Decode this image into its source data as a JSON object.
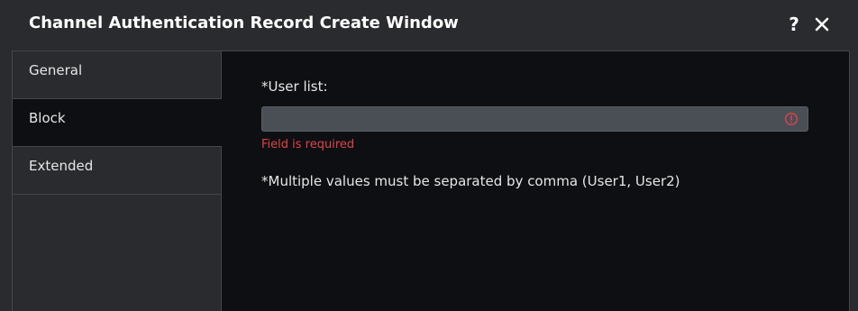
{
  "window": {
    "title": "Channel Authentication Record Create Window",
    "help_label": "?",
    "close_icon": "close-icon"
  },
  "tabs": [
    {
      "label": "General",
      "active": false
    },
    {
      "label": "Block",
      "active": true
    },
    {
      "label": "Extended",
      "active": false
    }
  ],
  "form": {
    "user_list_label": "*User list:",
    "user_list_value": "",
    "error_icon": "alert-circle-icon",
    "error_message": "Field is required",
    "hint": "*Multiple values must be separated by comma (User1, User2)"
  },
  "colors": {
    "background": "#2a2b2e",
    "content_background": "#0e0f12",
    "input_background": "#4a4f55",
    "error": "#e0434b",
    "text": "#e6e6e6"
  }
}
